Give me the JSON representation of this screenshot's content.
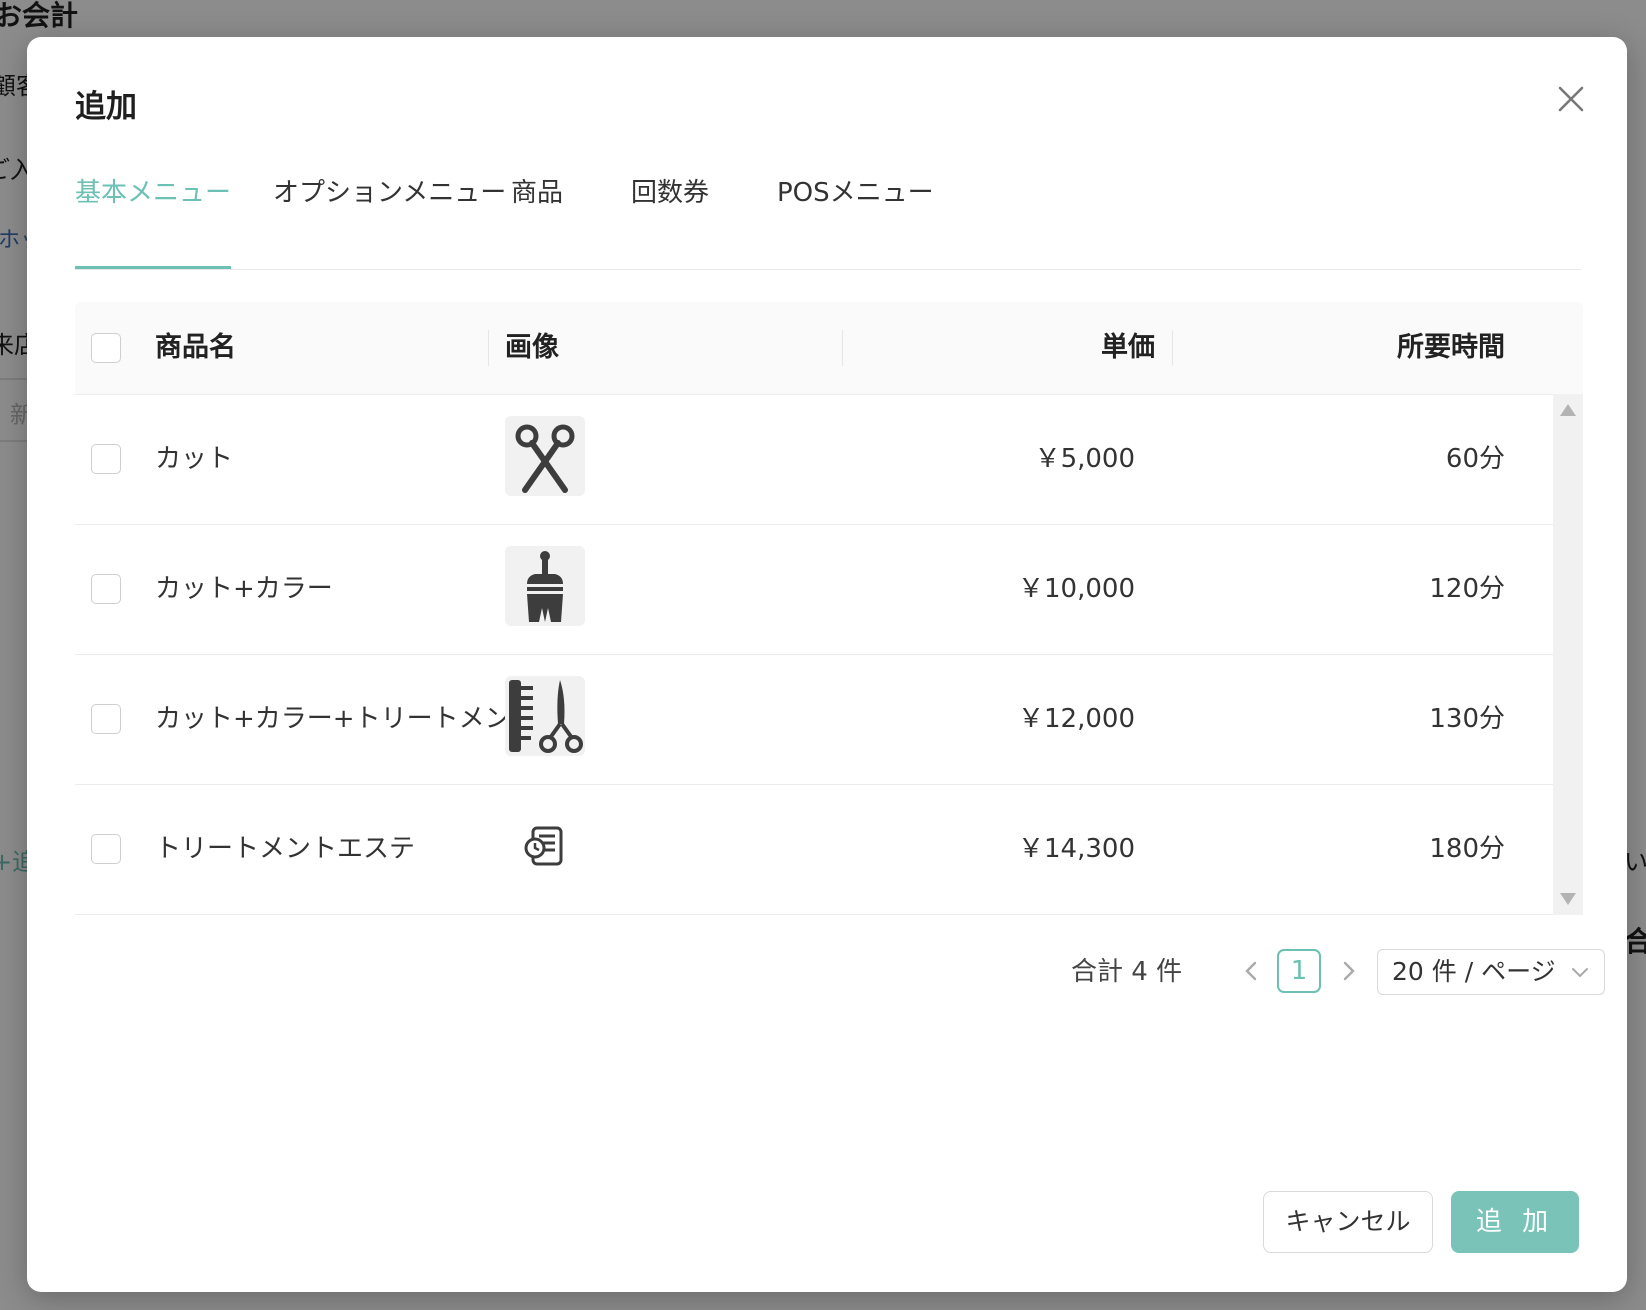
{
  "background": {
    "title_fragment": "お会計",
    "labels": [
      "顧客",
      "ご入",
      "ホッ",
      "来店",
      "新",
      "+追",
      "い計",
      "合"
    ]
  },
  "dialog": {
    "title": "追加",
    "close_icon": "close-icon",
    "accent_color": "#6cc0b4",
    "tabs": [
      {
        "label": "基本メニュー",
        "active": true
      },
      {
        "label": "オプションメニュー",
        "active": false
      },
      {
        "label": "商品",
        "active": false
      },
      {
        "label": "回数券",
        "active": false
      },
      {
        "label": "POSメニュー",
        "active": false
      }
    ],
    "table": {
      "columns": {
        "name": "商品名",
        "image": "画像",
        "price": "単価",
        "duration": "所要時間"
      },
      "rows": [
        {
          "name": "カット",
          "icon": "scissors-icon",
          "price": "￥5,000",
          "duration": "60分"
        },
        {
          "name": "カット+カラー",
          "icon": "hair-dye-brush-icon",
          "price": "￥10,000",
          "duration": "120分"
        },
        {
          "name": "カット+カラー+トリートメント",
          "icon": "comb-scissors-icon",
          "price": "￥12,000",
          "duration": "130分"
        },
        {
          "name": "トリートメントエステ",
          "icon": "clock-document-icon",
          "price": "￥14,300",
          "duration": "180分"
        }
      ]
    },
    "pagination": {
      "total": "合計 4 件",
      "current_page": "1",
      "page_size": "20 件 / ページ"
    },
    "buttons": {
      "cancel": "キャンセル",
      "add": "追 加",
      "add_color": "#79c3b9"
    }
  }
}
